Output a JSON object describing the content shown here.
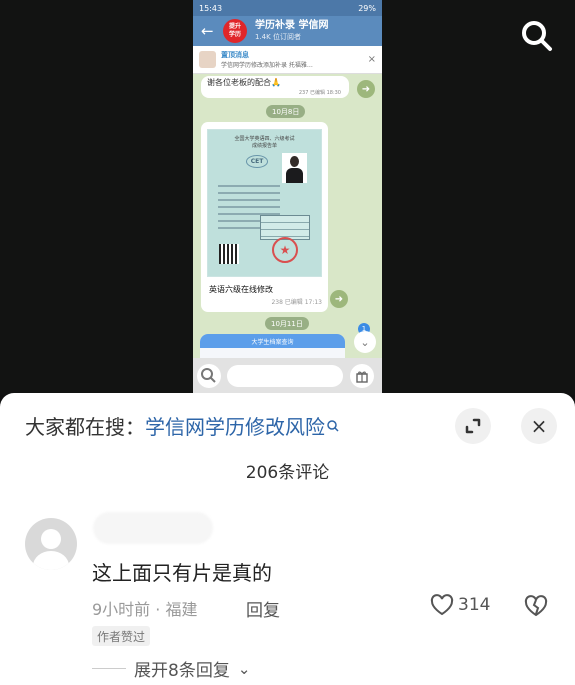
{
  "background": {
    "search_icon": "search-icon"
  },
  "phone": {
    "status": {
      "time": "15:43",
      "battery": "29%"
    },
    "channel": {
      "avatar_text": "提升\n学历",
      "title": "学历补录 学信网",
      "subtitle": "1.4K 位订阅者"
    },
    "pinned": {
      "title": "置顶消息",
      "text": "学信网学历修改添加补录 托福雅…"
    },
    "old_message": {
      "text": "谢各位老板的配合🙏",
      "meta": "237 已编辑 18:30"
    },
    "dates": [
      "10月8日",
      "10月11日"
    ],
    "certificate": {
      "header": "全国大学英语四、六级考试\n成绩报告单",
      "logo": "CET",
      "caption": "英语六级在线修改",
      "meta": "238 已编辑 17:13"
    },
    "new_message": {
      "header": "大学生档案查询"
    },
    "unread_badge": "1"
  },
  "comments_sheet": {
    "search_prefix": "大家都在搜：",
    "search_term": "学信网学历修改风险",
    "comment_count": "206条评论",
    "comment": {
      "text": "这上面只有片是真的",
      "time_location": "9小时前 · 福建",
      "reply": "回复",
      "likes": "314",
      "author_badge": "作者赞过",
      "expand": "展开8条回复"
    }
  },
  "colors": {
    "link_blue": "#2d65a8",
    "telegram_blue": "#5b8bbd",
    "chat_green": "#d9e7c8"
  }
}
